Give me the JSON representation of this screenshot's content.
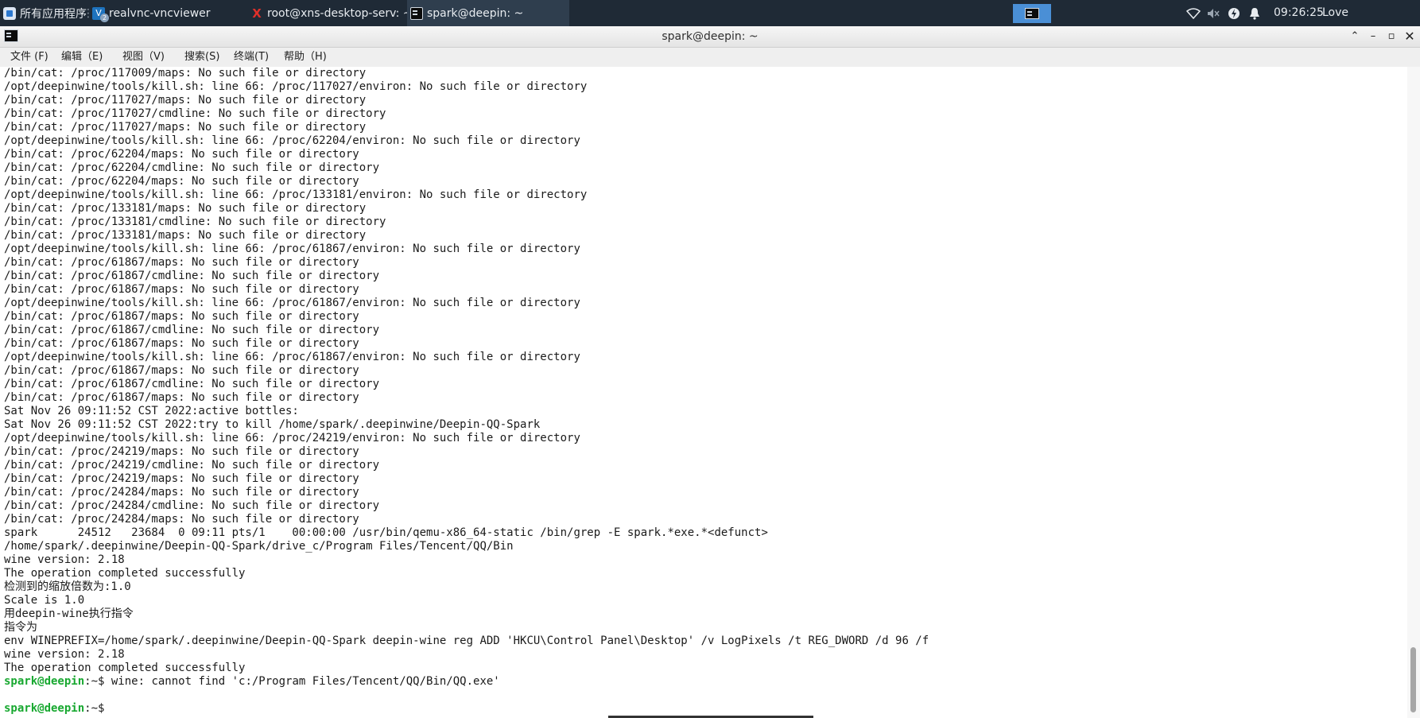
{
  "taskbar": {
    "start_label": "所有应用程序",
    "separator": "⋮",
    "tasks": [
      {
        "label": "realvnc-vncviewer",
        "badge": "2",
        "icon": "vnc-viewer-icon"
      },
      {
        "label": "root@xns-desktop-serv: ~",
        "icon": "xterm-icon"
      },
      {
        "label": "spark@deepin: ~",
        "icon": "terminal-icon",
        "active": true
      }
    ],
    "tray": {
      "wifi": "wifi-icon",
      "volume": "volume-muted-icon",
      "power": "power-icon",
      "notifications": "bell-icon"
    },
    "clock": "09:26:25",
    "user": "Love MengdaSecret"
  },
  "window": {
    "title": "spark@deepin: ~",
    "controls": [
      "⌃",
      "–",
      "▫",
      "✕"
    ]
  },
  "menu": {
    "items": [
      "文件 (F)",
      "编辑（E)",
      "视图（V)",
      "搜索(S)",
      "终端(T)",
      "帮助（H)"
    ]
  },
  "terminal": {
    "lines": [
      "/bin/cat: /proc/117009/maps: No such file or directory",
      "/opt/deepinwine/tools/kill.sh: line 66: /proc/117027/environ: No such file or directory",
      "/bin/cat: /proc/117027/maps: No such file or directory",
      "/bin/cat: /proc/117027/cmdline: No such file or directory",
      "/bin/cat: /proc/117027/maps: No such file or directory",
      "/opt/deepinwine/tools/kill.sh: line 66: /proc/62204/environ: No such file or directory",
      "/bin/cat: /proc/62204/maps: No such file or directory",
      "/bin/cat: /proc/62204/cmdline: No such file or directory",
      "/bin/cat: /proc/62204/maps: No such file or directory",
      "/opt/deepinwine/tools/kill.sh: line 66: /proc/133181/environ: No such file or directory",
      "/bin/cat: /proc/133181/maps: No such file or directory",
      "/bin/cat: /proc/133181/cmdline: No such file or directory",
      "/bin/cat: /proc/133181/maps: No such file or directory",
      "/opt/deepinwine/tools/kill.sh: line 66: /proc/61867/environ: No such file or directory",
      "/bin/cat: /proc/61867/maps: No such file or directory",
      "/bin/cat: /proc/61867/cmdline: No such file or directory",
      "/bin/cat: /proc/61867/maps: No such file or directory",
      "/opt/deepinwine/tools/kill.sh: line 66: /proc/61867/environ: No such file or directory",
      "/bin/cat: /proc/61867/maps: No such file or directory",
      "/bin/cat: /proc/61867/cmdline: No such file or directory",
      "/bin/cat: /proc/61867/maps: No such file or directory",
      "/opt/deepinwine/tools/kill.sh: line 66: /proc/61867/environ: No such file or directory",
      "/bin/cat: /proc/61867/maps: No such file or directory",
      "/bin/cat: /proc/61867/cmdline: No such file or directory",
      "/bin/cat: /proc/61867/maps: No such file or directory",
      "Sat Nov 26 09:11:52 CST 2022:active bottles:",
      "Sat Nov 26 09:11:52 CST 2022:try to kill /home/spark/.deepinwine/Deepin-QQ-Spark",
      "/opt/deepinwine/tools/kill.sh: line 66: /proc/24219/environ: No such file or directory",
      "/bin/cat: /proc/24219/maps: No such file or directory",
      "/bin/cat: /proc/24219/cmdline: No such file or directory",
      "/bin/cat: /proc/24219/maps: No such file or directory",
      "/bin/cat: /proc/24284/maps: No such file or directory",
      "/bin/cat: /proc/24284/cmdline: No such file or directory",
      "/bin/cat: /proc/24284/maps: No such file or directory",
      "spark      24512   23684  0 09:11 pts/1    00:00:00 /usr/bin/qemu-x86_64-static /bin/grep -E spark.*exe.*<defunct>",
      "/home/spark/.deepinwine/Deepin-QQ-Spark/drive_c/Program Files/Tencent/QQ/Bin",
      "wine version: 2.18",
      "The operation completed successfully",
      "检测到的缩放倍数为:1.0",
      "Scale is 1.0",
      "用deepin-wine执行指令",
      "指令为",
      "env WINEPREFIX=/home/spark/.deepinwine/Deepin-QQ-Spark deepin-wine reg ADD 'HKCU\\Control Panel\\Desktop' /v LogPixels /t REG_DWORD /d 96 /f",
      "wine version: 2.18",
      "The operation completed successfully"
    ],
    "prompt_user": "spark@deepin",
    "prompt_suffix": ":~$ ",
    "last_command_output": "wine: cannot find 'c:/Program Files/Tencent/QQ/Bin/QQ.exe'",
    "prompt_color": "#18a830"
  }
}
